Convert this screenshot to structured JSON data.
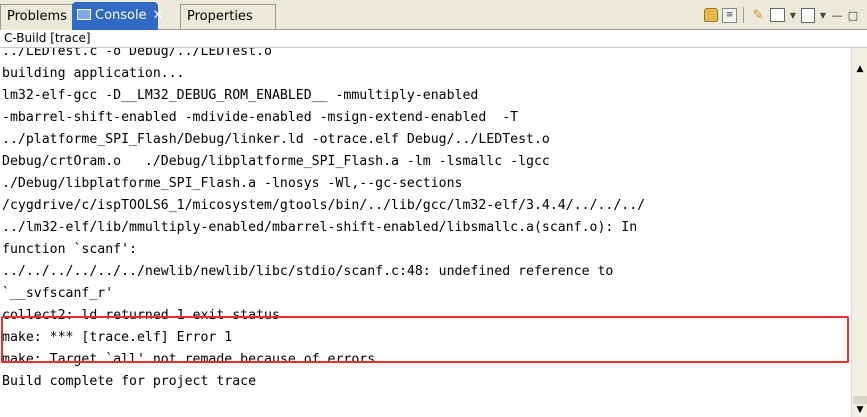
{
  "tabs": [
    {
      "label": "Problems"
    },
    {
      "label": "Console"
    },
    {
      "label": "Properties"
    }
  ],
  "toolbar": {
    "icons": [
      "lock-icon",
      "scroll-lock-icon",
      "pin-console-icon",
      "display-console-icon",
      "open-console-icon",
      "minimize-icon",
      "maximize-icon"
    ],
    "minimize": "—",
    "maximize": "□"
  },
  "console": {
    "title": "C-Build [trace]",
    "lines": [
      "../LEDTest.c -o Debug/../LEDTest.o",
      "building application...",
      "lm32-elf-gcc -D__LM32_DEBUG_ROM_ENABLED__ -mmultiply-enabled",
      "-mbarrel-shift-enabled -mdivide-enabled -msign-extend-enabled  -T",
      "../platforme_SPI_Flash/Debug/linker.ld -otrace.elf Debug/../LEDTest.o",
      "Debug/crtOram.o   ./Debug/libplatforme_SPI_Flash.a -lm -lsmallc -lgcc",
      "./Debug/libplatforme_SPI_Flash.a -lnosys -Wl,--gc-sections",
      "/cygdrive/c/ispTOOLS6_1/micosystem/gtools/bin/../lib/gcc/lm32-elf/3.4.4/../../../",
      "../lm32-elf/lib/mmultiply-enabled/mbarrel-shift-enabled/libsmallc.a(scanf.o): In",
      "function `scanf':",
      "../../../../../../newlib/newlib/libc/stdio/scanf.c:48: undefined reference to",
      "`__svfscanf_r'",
      "collect2: ld returned 1 exit status",
      "make: *** [trace.elf] Error 1",
      "make: Target `all' not remade because of errors.",
      "Build complete for project trace"
    ]
  },
  "colors": {
    "active_tab": "#3169c6",
    "highlight_border": "#e8302a"
  }
}
